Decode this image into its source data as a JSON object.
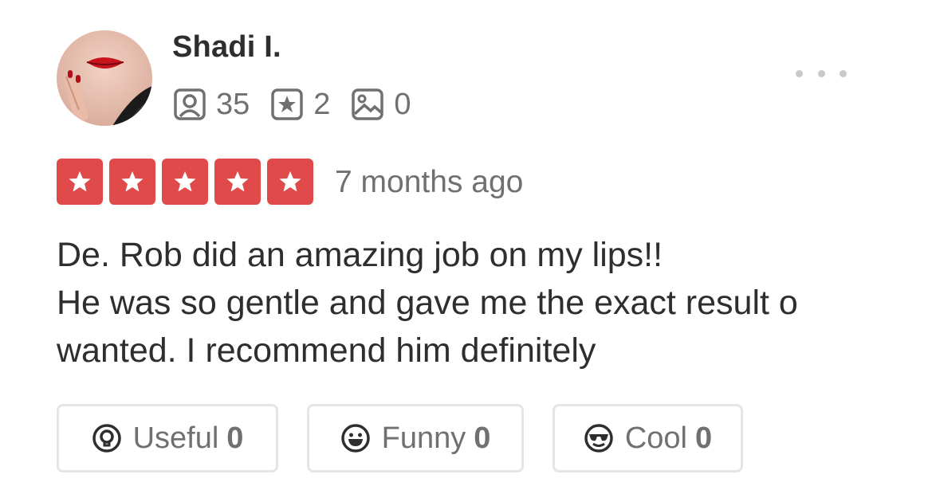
{
  "user": {
    "name": "Shadi I.",
    "friends_count": "35",
    "reviews_count": "2",
    "photos_count": "0"
  },
  "review": {
    "rating": 5,
    "date": "7 months ago",
    "lines": [
      "De. Rob did an amazing job on my lips!!",
      "He was so gentle and gave me the exact result o",
      "wanted. I recommend him definitely"
    ]
  },
  "reactions": {
    "useful": {
      "label": "Useful",
      "count": "0"
    },
    "funny": {
      "label": "Funny",
      "count": "0"
    },
    "cool": {
      "label": "Cool",
      "count": "0"
    }
  },
  "colors": {
    "star_red": "#e04a4a",
    "text_dark": "#2d2e2f",
    "text_gray": "#6e7072",
    "border_gray": "#e4e5e6"
  },
  "icons": {
    "friends": "friends-icon",
    "reviews": "reviews-star-icon",
    "photos": "photos-icon",
    "more": "more-options-icon",
    "useful": "useful-lightbulb-icon",
    "funny": "funny-face-icon",
    "cool": "cool-sunglasses-icon"
  }
}
